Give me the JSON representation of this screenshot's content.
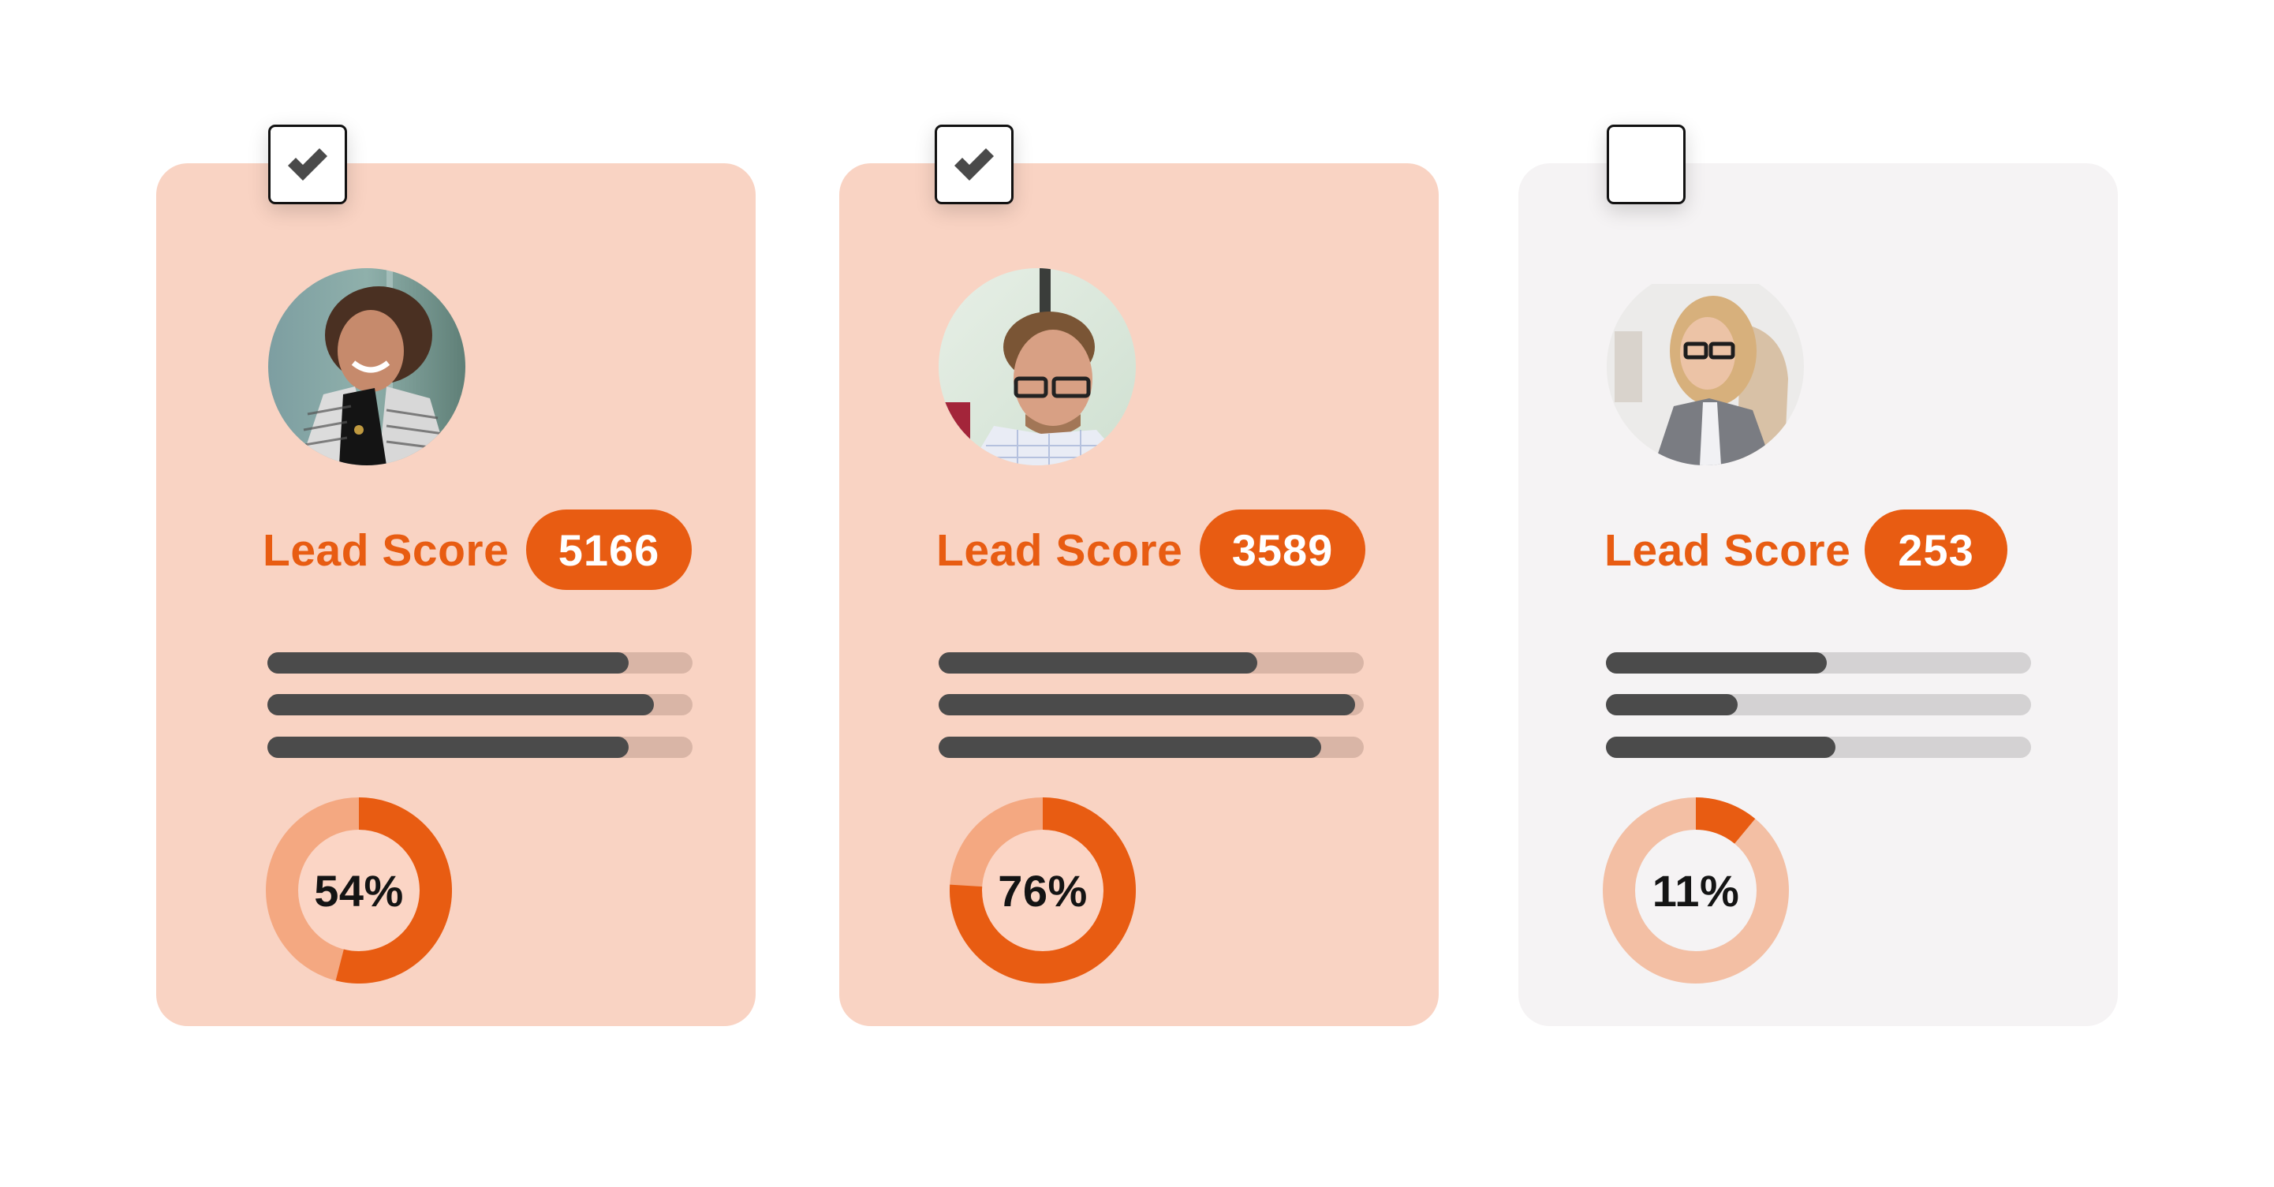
{
  "colors": {
    "accent": "#e85c12",
    "selected_card_bg": "#f9d3c3",
    "unselected_card_bg": "#f5f3f4",
    "bar_fill": "#4b4b4b",
    "selected_bar_track": "#d9b5a6",
    "unselected_bar_track": "#d4d2d3",
    "selected_donut_track": "#f4a881",
    "unselected_donut_track": "#f3bfa4",
    "selected_donut_center": "#fbd5c5"
  },
  "cards": [
    {
      "selected": true,
      "checkbox_icon": "checkmark-icon",
      "avatar": "woman-curly-hair-striped-cardigan",
      "lead_label": "Lead Score",
      "score": "5166",
      "bars": [
        0.85,
        0.91,
        0.85
      ],
      "percent": 54,
      "percent_label": "54%"
    },
    {
      "selected": true,
      "checkbox_icon": "checkmark-icon",
      "avatar": "man-glasses-checked-shirt",
      "lead_label": "Lead Score",
      "score": "3589",
      "bars": [
        0.75,
        0.98,
        0.9
      ],
      "percent": 76,
      "percent_label": "76%"
    },
    {
      "selected": false,
      "checkbox_icon": "",
      "avatar": "blonde-woman-glasses-grey-blazer",
      "lead_label": "Lead Score",
      "score": "253",
      "bars": [
        0.52,
        0.31,
        0.54
      ],
      "percent": 11,
      "percent_label": "11%"
    }
  ]
}
